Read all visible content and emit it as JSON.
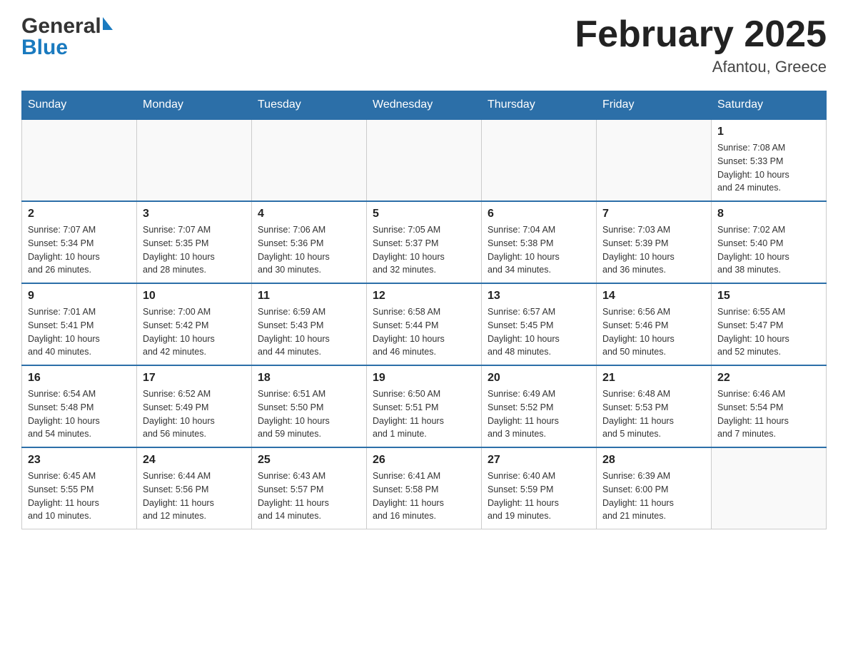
{
  "header": {
    "logo_general": "General",
    "logo_blue": "Blue",
    "title": "February 2025",
    "subtitle": "Afantou, Greece"
  },
  "calendar": {
    "days_of_week": [
      "Sunday",
      "Monday",
      "Tuesday",
      "Wednesday",
      "Thursday",
      "Friday",
      "Saturday"
    ],
    "weeks": [
      {
        "days": [
          {
            "num": "",
            "info": ""
          },
          {
            "num": "",
            "info": ""
          },
          {
            "num": "",
            "info": ""
          },
          {
            "num": "",
            "info": ""
          },
          {
            "num": "",
            "info": ""
          },
          {
            "num": "",
            "info": ""
          },
          {
            "num": "1",
            "info": "Sunrise: 7:08 AM\nSunset: 5:33 PM\nDaylight: 10 hours\nand 24 minutes."
          }
        ]
      },
      {
        "days": [
          {
            "num": "2",
            "info": "Sunrise: 7:07 AM\nSunset: 5:34 PM\nDaylight: 10 hours\nand 26 minutes."
          },
          {
            "num": "3",
            "info": "Sunrise: 7:07 AM\nSunset: 5:35 PM\nDaylight: 10 hours\nand 28 minutes."
          },
          {
            "num": "4",
            "info": "Sunrise: 7:06 AM\nSunset: 5:36 PM\nDaylight: 10 hours\nand 30 minutes."
          },
          {
            "num": "5",
            "info": "Sunrise: 7:05 AM\nSunset: 5:37 PM\nDaylight: 10 hours\nand 32 minutes."
          },
          {
            "num": "6",
            "info": "Sunrise: 7:04 AM\nSunset: 5:38 PM\nDaylight: 10 hours\nand 34 minutes."
          },
          {
            "num": "7",
            "info": "Sunrise: 7:03 AM\nSunset: 5:39 PM\nDaylight: 10 hours\nand 36 minutes."
          },
          {
            "num": "8",
            "info": "Sunrise: 7:02 AM\nSunset: 5:40 PM\nDaylight: 10 hours\nand 38 minutes."
          }
        ]
      },
      {
        "days": [
          {
            "num": "9",
            "info": "Sunrise: 7:01 AM\nSunset: 5:41 PM\nDaylight: 10 hours\nand 40 minutes."
          },
          {
            "num": "10",
            "info": "Sunrise: 7:00 AM\nSunset: 5:42 PM\nDaylight: 10 hours\nand 42 minutes."
          },
          {
            "num": "11",
            "info": "Sunrise: 6:59 AM\nSunset: 5:43 PM\nDaylight: 10 hours\nand 44 minutes."
          },
          {
            "num": "12",
            "info": "Sunrise: 6:58 AM\nSunset: 5:44 PM\nDaylight: 10 hours\nand 46 minutes."
          },
          {
            "num": "13",
            "info": "Sunrise: 6:57 AM\nSunset: 5:45 PM\nDaylight: 10 hours\nand 48 minutes."
          },
          {
            "num": "14",
            "info": "Sunrise: 6:56 AM\nSunset: 5:46 PM\nDaylight: 10 hours\nand 50 minutes."
          },
          {
            "num": "15",
            "info": "Sunrise: 6:55 AM\nSunset: 5:47 PM\nDaylight: 10 hours\nand 52 minutes."
          }
        ]
      },
      {
        "days": [
          {
            "num": "16",
            "info": "Sunrise: 6:54 AM\nSunset: 5:48 PM\nDaylight: 10 hours\nand 54 minutes."
          },
          {
            "num": "17",
            "info": "Sunrise: 6:52 AM\nSunset: 5:49 PM\nDaylight: 10 hours\nand 56 minutes."
          },
          {
            "num": "18",
            "info": "Sunrise: 6:51 AM\nSunset: 5:50 PM\nDaylight: 10 hours\nand 59 minutes."
          },
          {
            "num": "19",
            "info": "Sunrise: 6:50 AM\nSunset: 5:51 PM\nDaylight: 11 hours\nand 1 minute."
          },
          {
            "num": "20",
            "info": "Sunrise: 6:49 AM\nSunset: 5:52 PM\nDaylight: 11 hours\nand 3 minutes."
          },
          {
            "num": "21",
            "info": "Sunrise: 6:48 AM\nSunset: 5:53 PM\nDaylight: 11 hours\nand 5 minutes."
          },
          {
            "num": "22",
            "info": "Sunrise: 6:46 AM\nSunset: 5:54 PM\nDaylight: 11 hours\nand 7 minutes."
          }
        ]
      },
      {
        "days": [
          {
            "num": "23",
            "info": "Sunrise: 6:45 AM\nSunset: 5:55 PM\nDaylight: 11 hours\nand 10 minutes."
          },
          {
            "num": "24",
            "info": "Sunrise: 6:44 AM\nSunset: 5:56 PM\nDaylight: 11 hours\nand 12 minutes."
          },
          {
            "num": "25",
            "info": "Sunrise: 6:43 AM\nSunset: 5:57 PM\nDaylight: 11 hours\nand 14 minutes."
          },
          {
            "num": "26",
            "info": "Sunrise: 6:41 AM\nSunset: 5:58 PM\nDaylight: 11 hours\nand 16 minutes."
          },
          {
            "num": "27",
            "info": "Sunrise: 6:40 AM\nSunset: 5:59 PM\nDaylight: 11 hours\nand 19 minutes."
          },
          {
            "num": "28",
            "info": "Sunrise: 6:39 AM\nSunset: 6:00 PM\nDaylight: 11 hours\nand 21 minutes."
          },
          {
            "num": "",
            "info": ""
          }
        ]
      }
    ]
  }
}
